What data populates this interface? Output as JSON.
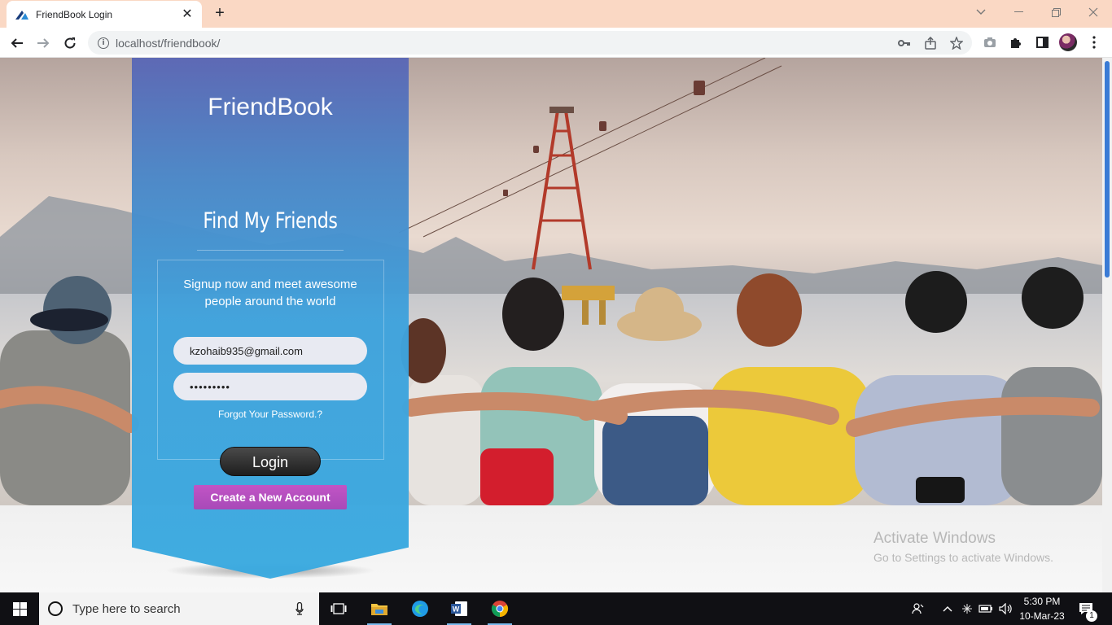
{
  "browser": {
    "tab_title": "FriendBook Login",
    "url": "localhost/friendbook/"
  },
  "page": {
    "brand": "FriendBook",
    "heading": "Find My Friends",
    "tagline_line1": "Signup now and meet awesome",
    "tagline_line2": "people around the world",
    "email_value": "kzohaib935@gmail.com",
    "password_value": "•••••••••",
    "forgot_label": "Forgot Your Password.?",
    "login_label": "Login",
    "create_label": "Create a New Account"
  },
  "watermark": {
    "line1": "Activate Windows",
    "line2": "Go to Settings to activate Windows."
  },
  "taskbar": {
    "search_placeholder": "Type here to search",
    "time": "5:30 PM",
    "date": "10-Mar-23",
    "notification_count": "1"
  },
  "colors": {
    "banner_top": "#5b67b5",
    "banner_bottom": "#3aaae0",
    "create_button": "#c154c5",
    "tab_strip": "#fad8c4"
  }
}
